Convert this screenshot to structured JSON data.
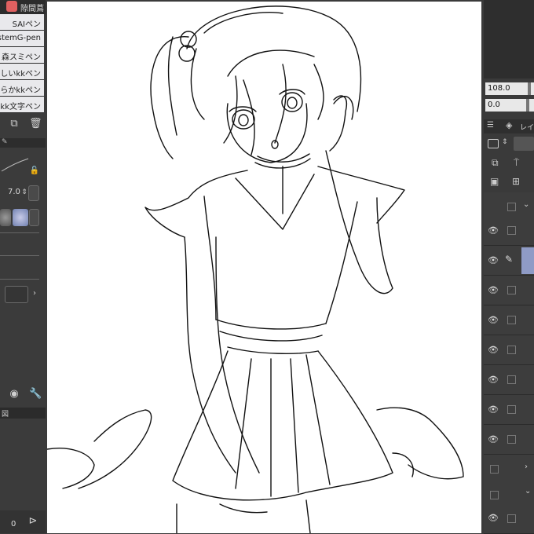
{
  "brush_list": {
    "items": [
      {
        "label": "SAIペン"
      },
      {
        "label": "stemG-pen"
      },
      {
        "label": "森スミペン"
      },
      {
        "label": "しいkkペン"
      },
      {
        "label": "らかkkペン"
      },
      {
        "label": "kk文字ペン"
      }
    ],
    "top_label": "隙間蔦"
  },
  "tool_property": {
    "size_value": "7.0"
  },
  "bottom_left": {
    "label": "図",
    "counter": "0"
  },
  "right_panel": {
    "opacity_value": "108.0",
    "second_value": "0.0",
    "layer_tab_label": "レイ"
  },
  "layers": {
    "rows": 12
  },
  "icons": [
    "eye-icon",
    "pen-icon",
    "wrench-icon",
    "trash-icon",
    "copy-icon",
    "lock-icon",
    "play-icon"
  ]
}
